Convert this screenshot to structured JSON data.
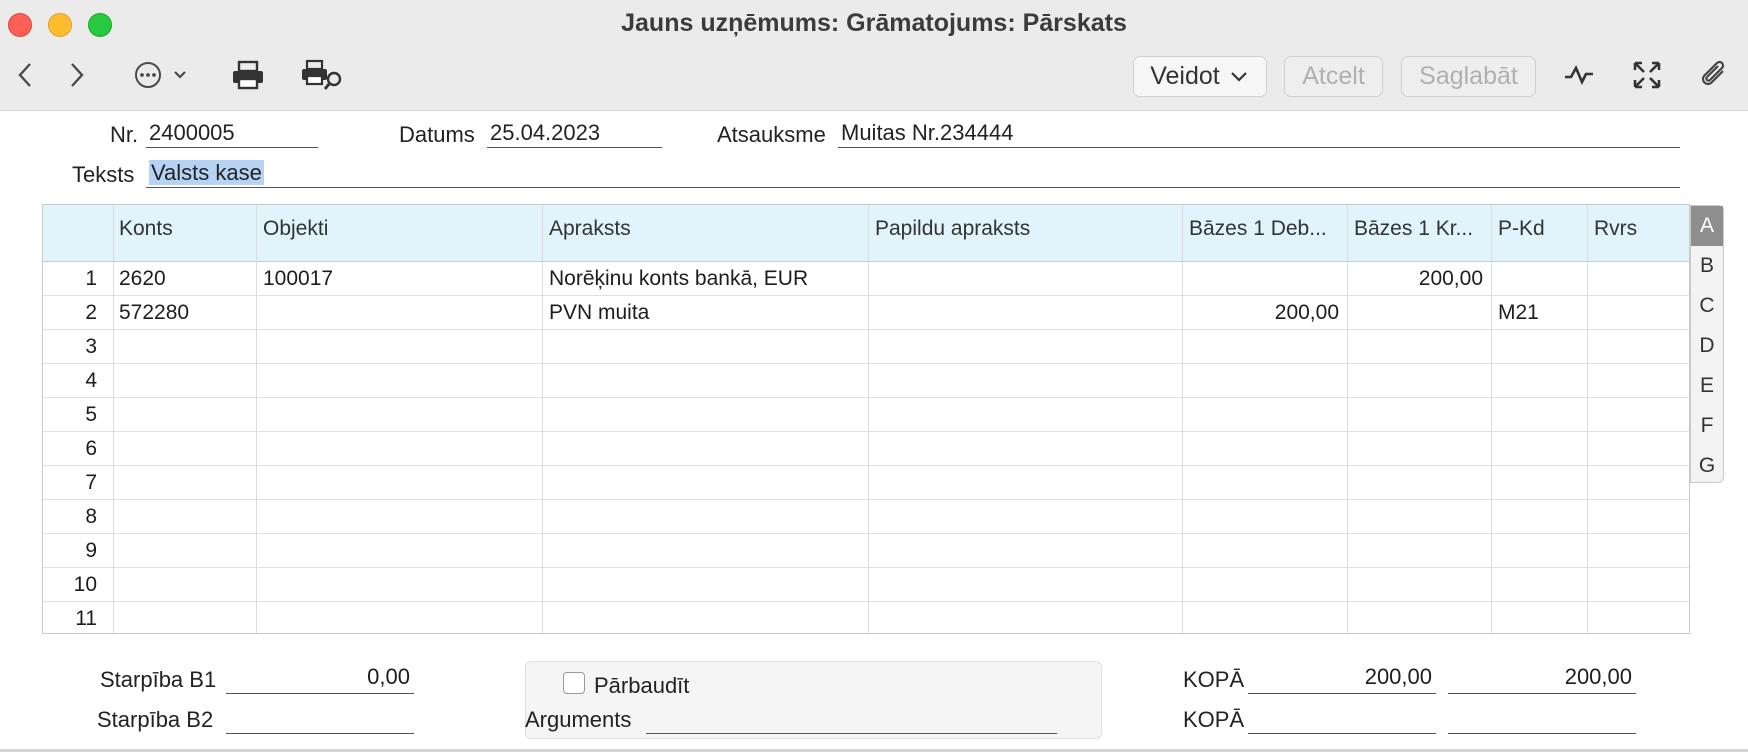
{
  "window": {
    "title": "Jauns uzņēmums: Grāmatojums: Pārskats"
  },
  "toolbar": {
    "veidot": "Veidot",
    "atcelt": "Atcelt",
    "saglabat": "Saglabāt",
    "icons": [
      "back-icon",
      "forward-icon",
      "more-icon",
      "print-icon",
      "print-preview-icon",
      "activity-icon",
      "fullscreen-icon",
      "attachment-icon"
    ]
  },
  "header": {
    "nr_label": "Nr.",
    "nr_value": "2400005",
    "datums_label": "Datums",
    "datums_value": "25.04.2023",
    "atsauksme_label": "Atsauksme",
    "atsauksme_value": "Muitas Nr.234444",
    "teksts_label": "Teksts",
    "teksts_value": "Valsts kase"
  },
  "grid": {
    "columns": [
      "Konts",
      "Objekti",
      "Apraksts",
      "Papildu apraksts",
      "Bāzes 1 Deb...",
      "Bāzes 1 Kr...",
      "P-Kd",
      "Rvrs"
    ],
    "rows": [
      {
        "n": "1",
        "konts": "2620",
        "objekti": "100017",
        "apraksts": "Norēķinu konts bankā, EUR",
        "papildu": "",
        "debets": "",
        "kredits": "200,00",
        "pkd": "",
        "rvrs": ""
      },
      {
        "n": "2",
        "konts": "572280",
        "objekti": "",
        "apraksts": "PVN muita",
        "papildu": "",
        "debets": "200,00",
        "kredits": "",
        "pkd": "M21",
        "rvrs": ""
      },
      {
        "n": "3",
        "konts": "",
        "objekti": "",
        "apraksts": "",
        "papildu": "",
        "debets": "",
        "kredits": "",
        "pkd": "",
        "rvrs": ""
      },
      {
        "n": "4",
        "konts": "",
        "objekti": "",
        "apraksts": "",
        "papildu": "",
        "debets": "",
        "kredits": "",
        "pkd": "",
        "rvrs": ""
      },
      {
        "n": "5",
        "konts": "",
        "objekti": "",
        "apraksts": "",
        "papildu": "",
        "debets": "",
        "kredits": "",
        "pkd": "",
        "rvrs": ""
      },
      {
        "n": "6",
        "konts": "",
        "objekti": "",
        "apraksts": "",
        "papildu": "",
        "debets": "",
        "kredits": "",
        "pkd": "",
        "rvrs": ""
      },
      {
        "n": "7",
        "konts": "",
        "objekti": "",
        "apraksts": "",
        "papildu": "",
        "debets": "",
        "kredits": "",
        "pkd": "",
        "rvrs": ""
      },
      {
        "n": "8",
        "konts": "",
        "objekti": "",
        "apraksts": "",
        "papildu": "",
        "debets": "",
        "kredits": "",
        "pkd": "",
        "rvrs": ""
      },
      {
        "n": "9",
        "konts": "",
        "objekti": "",
        "apraksts": "",
        "papildu": "",
        "debets": "",
        "kredits": "",
        "pkd": "",
        "rvrs": ""
      },
      {
        "n": "10",
        "konts": "",
        "objekti": "",
        "apraksts": "",
        "papildu": "",
        "debets": "",
        "kredits": "",
        "pkd": "",
        "rvrs": ""
      },
      {
        "n": "11",
        "konts": "",
        "objekti": "",
        "apraksts": "",
        "papildu": "",
        "debets": "",
        "kredits": "",
        "pkd": "",
        "rvrs": ""
      }
    ],
    "side_tabs": [
      "A",
      "B",
      "C",
      "D",
      "E",
      "F",
      "G"
    ],
    "active_tab": "A"
  },
  "footer": {
    "starpiba_b1_label": "Starpība B1",
    "starpiba_b1_value": "0,00",
    "starpiba_b2_label": "Starpība B2",
    "starpiba_b2_value": "",
    "parbaudit_label": "Pārbaudīt",
    "argumenti_label": "Arguments",
    "argumenti_value": "",
    "kopa1_label": "KOPĀ",
    "kopa1_debets": "200,00",
    "kopa1_kredits": "200,00",
    "kopa2_label": "KOPĀ",
    "kopa2_debets": "",
    "kopa2_kredits": ""
  }
}
